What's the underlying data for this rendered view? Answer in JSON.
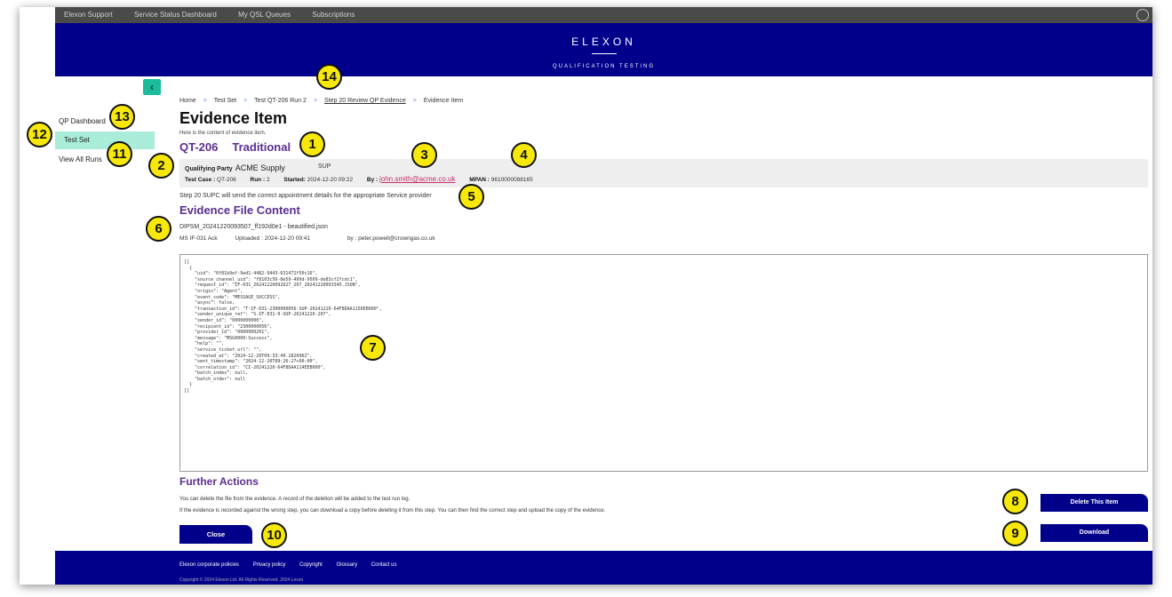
{
  "top_links": [
    "Elexon Support",
    "Service Status Dashboard",
    "My QSL Queues",
    "Subscriptions"
  ],
  "header": {
    "brand": "ELEXON",
    "subtitle": "QUALIFICATION TESTING"
  },
  "sidebar": {
    "collapse_icon": "chevron-left-icon",
    "items": [
      {
        "label": "QP Dashboard",
        "active": false
      },
      {
        "label": "Test Set",
        "active": true
      },
      {
        "label": "View All Runs",
        "active": false
      }
    ]
  },
  "breadcrumb": [
    "Home",
    "Test Set",
    "Test QT-206 Run 2",
    "Step 20 Review QP Evidence",
    "Evidence Item"
  ],
  "page": {
    "title": "Evidence Item",
    "intro": "Here is the content of evidence item.",
    "test_code": "QT-206",
    "test_type": "Traditional"
  },
  "info": {
    "party_label": "Qualifying Party",
    "party": "ACME Supply",
    "role": "SUP",
    "test_case_label": "Test Case :",
    "test_case": "QT-206",
    "run_label": "Run :",
    "run": "2",
    "started_label": "Started:",
    "started": "2024-12-20 09:22",
    "by_label": "By :",
    "by": "john.smith@acme.co.uk",
    "mpan_label": "MPAN :",
    "mpan": "9610000088165"
  },
  "step_text": "Step 20   SUPC will send the correct appointment details for the appropriate Service provider",
  "evidence": {
    "heading": "Evidence File Content",
    "filename": "DIPSM_20241220093507_ff192d0e1 - beautified.json",
    "message_type": "MS IF-031 Ack",
    "uploaded_label": "Uploaded :",
    "uploaded": "2024-12-20 09:41",
    "by_label": "by :",
    "by": "peter.powell@crowngas.co.uk",
    "content": "[[\n  {\n    \"uid\": \"6f81b9ef-9ed1-4482-9443-631472f50c16\",\n    \"source_channel_uid\": \"f8103c56-8e59-499d-9509-de83cf2fcdc1\",\n    \"request_id\": \"IF-031_20241220092627_207_20241220093345.JSON\",\n    \"origin\": \"Agent\",\n    \"event_code\": \"MESSAGE_SUCCESS\",\n    \"async\": false,\n    \"transaction_id\": \"T-IF-031-2300000056-SUP-20241220-64F8DAA1156EB000\",\n    \"sender_unique_ref\": \"S-IF-031-0-SUP-20241220-207\",\n    \"sender_id\": \"0000000000\",\n    \"recipient_id\": \"2300000056\",\n    \"provider_id\": \"0000000201\",\n    \"message\": \"MSG0000:Success\",\n    \"help\": \"\",\n    \"service_ticket_url\": \"\",\n    \"created_at\": \"2024-12-20T09:33:49.182096Z\",\n    \"sent_timestamp\": \"2024-12-20T09:26:27+00:00\",\n    \"correlation_id\": \"CI-20241220-64F8DAA114EEB000\",\n    \"batch_index\": null,\n    \"batch_order\": null\n  }\n]]"
  },
  "further": {
    "heading": "Further Actions",
    "line1": "You can delete the file from the evidence. A record of the deletion will be added to the test run log.",
    "line2": "If the evidence is recorded against the wrong step, you can download a copy before deleting it from this step. You can then find the correct step and upload the copy of the evidence."
  },
  "buttons": {
    "close": "Close",
    "delete": "Delete This Item",
    "download": "Download"
  },
  "footer": {
    "links": [
      "Elexon corporate policies",
      "Privacy policy",
      "Copyright",
      "Glossary",
      "Contact us"
    ],
    "copyright": "Copyright © 2024 Elexon Ltd. All Rights Reserved. 2024 Lexon"
  },
  "annotations": [
    "1",
    "2",
    "3",
    "4",
    "5",
    "6",
    "7",
    "8",
    "9",
    "10",
    "11",
    "12",
    "13",
    "14"
  ],
  "colors": {
    "navy": "#00008b",
    "purple": "#5a2d91",
    "teal": "#1bbc9b",
    "active_bg": "#a8ecd9",
    "badge": "#f7e80a",
    "email": "#c22f6c"
  }
}
